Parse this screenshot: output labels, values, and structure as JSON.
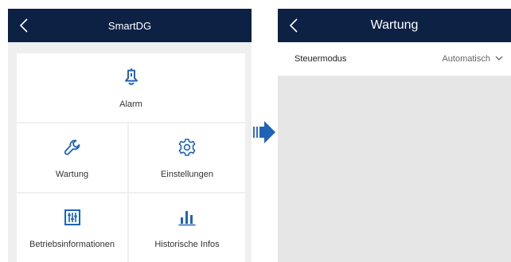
{
  "colors": {
    "header_bg": "#0d2145",
    "header_text": "#ffffff",
    "accent": "#1f63b8",
    "panel_bg": "#efefef",
    "tile_bg": "#ffffff"
  },
  "left_screen": {
    "title": "SmartDG",
    "back_icon": "chevron-left-icon",
    "tiles": [
      {
        "label": "Alarm",
        "icon": "bell-icon"
      },
      {
        "label": "Wartung",
        "icon": "wrench-icon"
      },
      {
        "label": "Einstellungen",
        "icon": "gear-icon"
      },
      {
        "label": "Betriebsinformationen",
        "icon": "sliders-icon"
      },
      {
        "label": "Historische Infos",
        "icon": "bar-chart-icon"
      }
    ]
  },
  "transition_icon": "arrow-right-icon",
  "right_screen": {
    "title": "Wartung",
    "back_icon": "chevron-left-icon",
    "setting": {
      "label": "Steuermodus",
      "value": "Automatisch",
      "icon": "chevron-down-icon"
    }
  }
}
